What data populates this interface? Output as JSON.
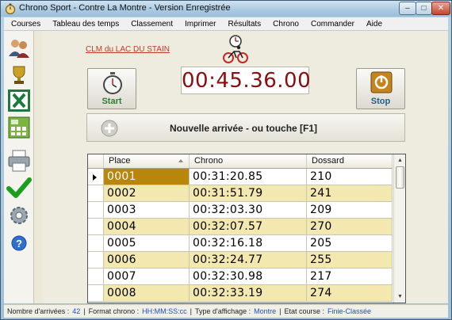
{
  "window": {
    "title": "Chrono Sport - Contre La Montre - Version Enregistrée",
    "buttons": {
      "minimize": "–",
      "maximize": "□",
      "close": "✕"
    }
  },
  "menu": [
    "Courses",
    "Tableau des temps",
    "Classement",
    "Imprimer",
    "Résultats",
    "Chrono",
    "Commander",
    "Aide"
  ],
  "toolbar": {
    "icons": [
      "users-icon",
      "trophy-icon",
      "excel-icon",
      "calculator-icon",
      "printer-icon",
      "checkmark-icon",
      "settings-gear-icon",
      "help-icon"
    ]
  },
  "race": {
    "name": "CLM du LAC DU STAIN",
    "timer": "00:45.36.00",
    "start_label": "Start",
    "stop_label": "Stop",
    "arrival_label": "Nouvelle arrivée   -   ou touche [F1]"
  },
  "grid": {
    "columns": [
      "Place",
      "Chrono",
      "Dossard"
    ],
    "rows": [
      {
        "place": "0001",
        "chrono": "00:31:20.85",
        "dossard": "210"
      },
      {
        "place": "0002",
        "chrono": "00:31:51.79",
        "dossard": "241"
      },
      {
        "place": "0003",
        "chrono": "00:32:03.30",
        "dossard": "209"
      },
      {
        "place": "0004",
        "chrono": "00:32:07.57",
        "dossard": "270"
      },
      {
        "place": "0005",
        "chrono": "00:32:16.18",
        "dossard": "205"
      },
      {
        "place": "0006",
        "chrono": "00:32:24.77",
        "dossard": "255"
      },
      {
        "place": "0007",
        "chrono": "00:32:30.98",
        "dossard": "217"
      },
      {
        "place": "0008",
        "chrono": "00:32:33.19",
        "dossard": "274"
      }
    ]
  },
  "status": {
    "arrivals_label": "Nombre d'arrivées :",
    "arrivals_value": "42",
    "format_label": "Format chrono :",
    "format_value": "HH:MM:SS:cc",
    "display_label": "Type d'affichage :",
    "display_value": "Montre",
    "state_label": "Etat course :",
    "state_value": "Finie-Classée"
  },
  "colors": {
    "timer_text": "#8b0e0e",
    "row_highlight": "#f3e9b0",
    "active_cell": "#b8860b",
    "link": "#c0392b",
    "status_value": "#1f4fb8"
  }
}
